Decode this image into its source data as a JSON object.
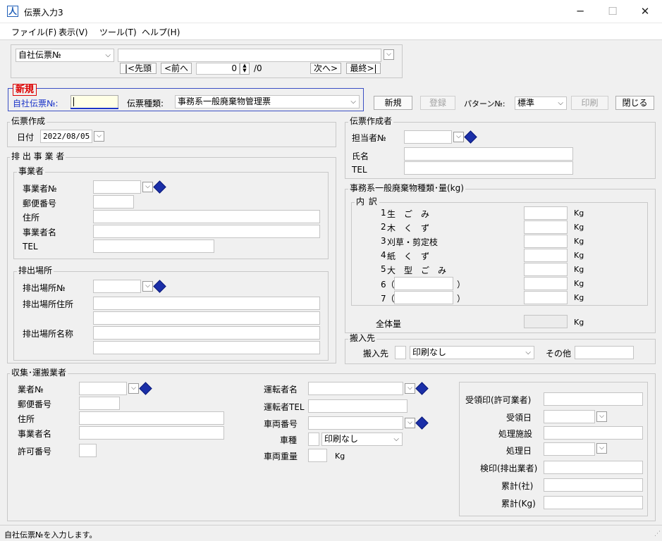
{
  "window": {
    "title": "伝票入力3",
    "minimize": "─",
    "maximize": "☐",
    "close": "✕"
  },
  "menu": [
    "ファイル(F)",
    "表示(V)",
    "ツール(T)",
    "ヘルプ(H)"
  ],
  "nav": {
    "slip_type": "自社伝票№",
    "first": "|<先頭",
    "prev": "<前へ",
    "page_value": "0",
    "page_total": "/0",
    "next": "次へ>",
    "last": "最終>|"
  },
  "mode": {
    "title": "新規",
    "slip_no_label": "自社伝票№:",
    "slip_kind_label": "伝票種類:",
    "slip_kind_value": "事務系一般廃棄物管理票"
  },
  "actions": {
    "new": "新規",
    "register": "登録",
    "pattern_label": "パターン№:",
    "pattern_value": "標準",
    "print": "印刷",
    "close": "閉じる"
  },
  "slip_creation": {
    "legend": "伝票作成",
    "date_label": "日付",
    "date_value": "2022/08/05"
  },
  "slip_creator": {
    "legend": "伝票作成者",
    "staff_no_label": "担当者№",
    "name_label": "氏名",
    "tel_label": "TEL"
  },
  "emitter": {
    "legend": "排 出 事 業 者",
    "business": {
      "legend": "事業者",
      "no_label": "事業者№",
      "postal_label": "郵便番号",
      "address_label": "住所",
      "name_label": "事業者名",
      "tel_label": "TEL"
    },
    "site": {
      "legend": "排出場所",
      "no_label": "排出場所№",
      "address_label": "排出場所住所",
      "name_label": "排出場所名称"
    }
  },
  "waste": {
    "legend": "事務系一般廃棄物種類･量(kg)",
    "breakdown_legend": "内 訳",
    "items": [
      {
        "no": "1",
        "name": "生　ご　み",
        "unit": "Kg"
      },
      {
        "no": "2",
        "name": "木　く　ず",
        "unit": "Kg"
      },
      {
        "no": "3",
        "name": "刈草・剪定枝",
        "unit": "Kg"
      },
      {
        "no": "4",
        "name": "紙　く　ず",
        "unit": "Kg"
      },
      {
        "no": "5",
        "name": "大　型　ご　み",
        "unit": "Kg"
      }
    ],
    "custom_items": [
      {
        "prefix": "6（",
        "suffix": "）",
        "unit": "Kg"
      },
      {
        "prefix": "7（",
        "suffix": "）",
        "unit": "Kg"
      }
    ],
    "total_label": "全体量",
    "total_unit": "Kg"
  },
  "destination": {
    "legend": "搬入先",
    "dest_label": "搬入先",
    "print_option": "印刷なし",
    "other_label": "その他"
  },
  "transporter": {
    "legend": "収集･運搬業者",
    "no_label": "業者№",
    "postal_label": "郵便番号",
    "address_label": "住所",
    "name_label": "事業者名",
    "permit_label": "許可番号",
    "driver_label": "運転者名",
    "driver_tel_label": "運転者TEL",
    "vehicle_no_label": "車両番号",
    "vehicle_type_label": "車種",
    "vehicle_type_print": "印刷なし",
    "vehicle_weight_label": "車両重量",
    "weight_unit": "Kg",
    "seal_label": "受領印(許可業者)",
    "received_date_label": "受領日",
    "facility_label": "処理施設",
    "processed_date_label": "処理日",
    "inspect_label": "検印(排出業者)",
    "cumulative_company_label": "累計(社)",
    "cumulative_kg_label": "累計(Kg)"
  },
  "status": {
    "text": "自社伝票№を入力します。"
  }
}
